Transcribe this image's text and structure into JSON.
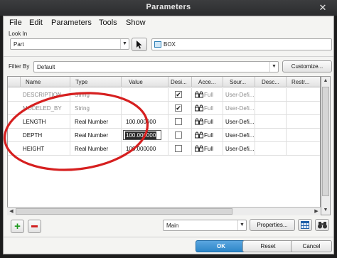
{
  "window": {
    "title": "Parameters",
    "close_glyph": "✕"
  },
  "menu": [
    "File",
    "Edit",
    "Parameters",
    "Tools",
    "Show"
  ],
  "look_in": {
    "label": "Look In",
    "scope": "Part",
    "object": "BOX"
  },
  "filter_by": {
    "label": "Filter By",
    "value": "Default",
    "customize_label": "Customize..."
  },
  "table": {
    "columns": [
      "Name",
      "Type",
      "Value",
      "Desi...",
      "Acce...",
      "Sour...",
      "Desc...",
      "Restr..."
    ],
    "rows": [
      {
        "name": "DESCRIPTION",
        "type": "String",
        "value": "",
        "designated": true,
        "access": "Full",
        "source": "User-Defi...",
        "readonly": true,
        "editing": false
      },
      {
        "name": "MODELED_BY",
        "type": "String",
        "value": "",
        "designated": true,
        "access": "Full",
        "source": "User-Defi...",
        "readonly": true,
        "editing": false
      },
      {
        "name": "LENGTH",
        "type": "Real Number",
        "value": "100.000000",
        "designated": false,
        "access": "Full",
        "source": "User-Defi...",
        "readonly": false,
        "editing": false
      },
      {
        "name": "DEPTH",
        "type": "Real Number",
        "value": "100.000000",
        "designated": false,
        "access": "Full",
        "source": "User-Defi...",
        "readonly": false,
        "editing": true
      },
      {
        "name": "HEIGHT",
        "type": "Real Number",
        "value": "100.000000",
        "designated": false,
        "access": "Full",
        "source": "User-Defi...",
        "readonly": false,
        "editing": false
      }
    ]
  },
  "bottom": {
    "add_icon": "plus-icon",
    "remove_icon": "minus-icon",
    "view": "Main",
    "properties_label": "Properties...",
    "ok_label": "OK",
    "reset_label": "Reset",
    "cancel_label": "Cancel"
  },
  "colors": {
    "titlebar": "#2b2c2e",
    "dialog_bg": "#f4f4f2",
    "annotation": "#d61f1f",
    "add_green": "#1f9a1f",
    "remove_red": "#d12020",
    "ok_blue": "#2d86c8"
  }
}
